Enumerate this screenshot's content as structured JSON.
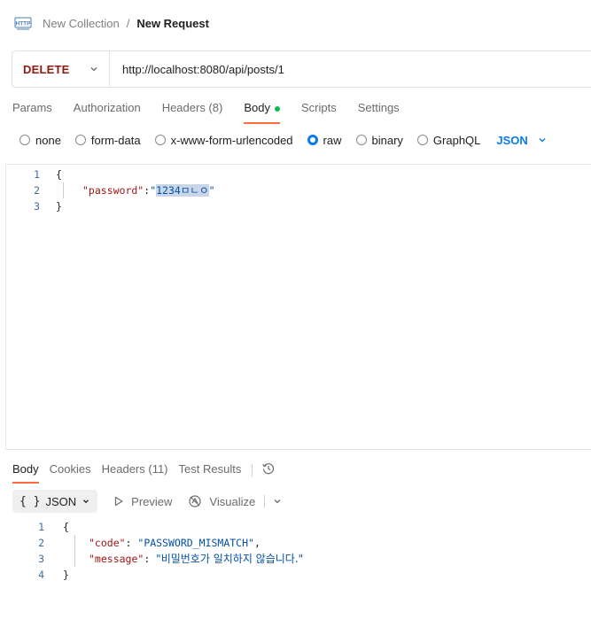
{
  "breadcrumb": {
    "icon": "http-icon",
    "collection": "New Collection",
    "separator": "/",
    "request": "New Request"
  },
  "url_bar": {
    "method": "DELETE",
    "url": "http://localhost:8080/api/posts/1"
  },
  "request_tabs": [
    {
      "label": "Params"
    },
    {
      "label": "Authorization"
    },
    {
      "label": "Headers (8)"
    },
    {
      "label": "Body",
      "active": true,
      "indicator": "green-dot"
    },
    {
      "label": "Scripts"
    },
    {
      "label": "Settings"
    }
  ],
  "body_types": [
    {
      "label": "none",
      "checked": false
    },
    {
      "label": "form-data",
      "checked": false
    },
    {
      "label": "x-www-form-urlencoded",
      "checked": false
    },
    {
      "label": "raw",
      "checked": true
    },
    {
      "label": "binary",
      "checked": false
    },
    {
      "label": "GraphQL",
      "checked": false
    }
  ],
  "raw_format": "JSON",
  "request_body": {
    "lines": [
      {
        "n": "1",
        "text": "{"
      },
      {
        "n": "2",
        "key": "\"password\"",
        "colon": ":",
        "quote_open": "\"",
        "value": "1234ㅁㄴㅇ",
        "quote_close": "\""
      },
      {
        "n": "3",
        "text": "}"
      }
    ]
  },
  "response_tabs": [
    {
      "label": "Body",
      "active": true
    },
    {
      "label": "Cookies"
    },
    {
      "label": "Headers (11)"
    },
    {
      "label": "Test Results"
    }
  ],
  "response_toolbar": {
    "format_icon": "{ }",
    "format": "JSON",
    "preview": "Preview",
    "visualize": "Visualize"
  },
  "response_body": {
    "lines": [
      {
        "n": "1",
        "text": "{"
      },
      {
        "n": "2",
        "key": "\"code\"",
        "sep": ": ",
        "value": "\"PASSWORD_MISMATCH\"",
        "tail": ","
      },
      {
        "n": "3",
        "key": "\"message\"",
        "sep": ": ",
        "value": "\"비밀번호가 일치하지 않습니다.\"",
        "tail": ""
      },
      {
        "n": "4",
        "text": "}"
      }
    ]
  },
  "colors": {
    "method": "#8e1a10",
    "accent_tab": "#ff6c37",
    "radio_checked": "#097bed",
    "json_key": "#a31515",
    "json_string": "#0451a5",
    "line_number": "#3d6e9e"
  }
}
